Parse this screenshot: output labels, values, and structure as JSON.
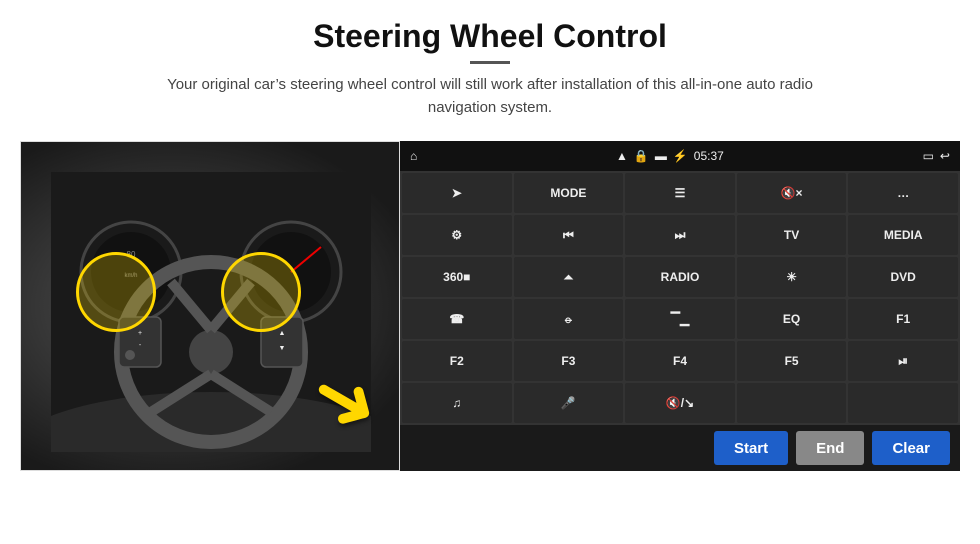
{
  "header": {
    "title": "Steering Wheel Control",
    "subtitle": "Your original car’s steering wheel control will still work after installation of this all-in-one auto radio navigation system."
  },
  "status_bar": {
    "home_icon": "⌂",
    "wifi_icon": "☁",
    "lock_icon": "🔒",
    "sd_icon": "⎙",
    "bt_icon": "⦿",
    "time": "05:37",
    "screen_icon": "☐",
    "back_icon": "↩"
  },
  "grid_buttons": [
    [
      {
        "label": "➤",
        "type": "icon"
      },
      {
        "label": "MODE",
        "type": "text"
      },
      {
        "label": "☰",
        "type": "icon"
      },
      {
        "label": "🔇×",
        "type": "icon"
      },
      {
        "label": "…",
        "type": "icon"
      }
    ],
    [
      {
        "label": "⚙",
        "type": "icon"
      },
      {
        "label": "⏮",
        "type": "icon"
      },
      {
        "label": "⏭",
        "type": "icon"
      },
      {
        "label": "TV",
        "type": "text"
      },
      {
        "label": "MEDIA",
        "type": "text"
      }
    ],
    [
      {
        "label": "360■",
        "type": "text"
      },
      {
        "label": "⏶",
        "type": "icon"
      },
      {
        "label": "RADIO",
        "type": "text"
      },
      {
        "label": "☀",
        "type": "icon"
      },
      {
        "label": "DVD",
        "type": "text"
      }
    ],
    [
      {
        "label": "☎",
        "type": "icon"
      },
      {
        "label": "⦵",
        "type": "icon"
      },
      {
        "label": "▔▁",
        "type": "icon"
      },
      {
        "label": "EQ",
        "type": "text"
      },
      {
        "label": "F1",
        "type": "text"
      }
    ],
    [
      {
        "label": "F2",
        "type": "text"
      },
      {
        "label": "F3",
        "type": "text"
      },
      {
        "label": "F4",
        "type": "text"
      },
      {
        "label": "F5",
        "type": "text"
      },
      {
        "label": "⏯",
        "type": "icon"
      }
    ],
    [
      {
        "label": "♫",
        "type": "icon"
      },
      {
        "label": "🎤",
        "type": "icon"
      },
      {
        "label": "🔇/↘",
        "type": "icon"
      },
      {
        "label": "",
        "type": "empty"
      },
      {
        "label": "",
        "type": "empty"
      }
    ]
  ],
  "bottom_bar": {
    "start_label": "Start",
    "end_label": "End",
    "clear_label": "Clear"
  }
}
